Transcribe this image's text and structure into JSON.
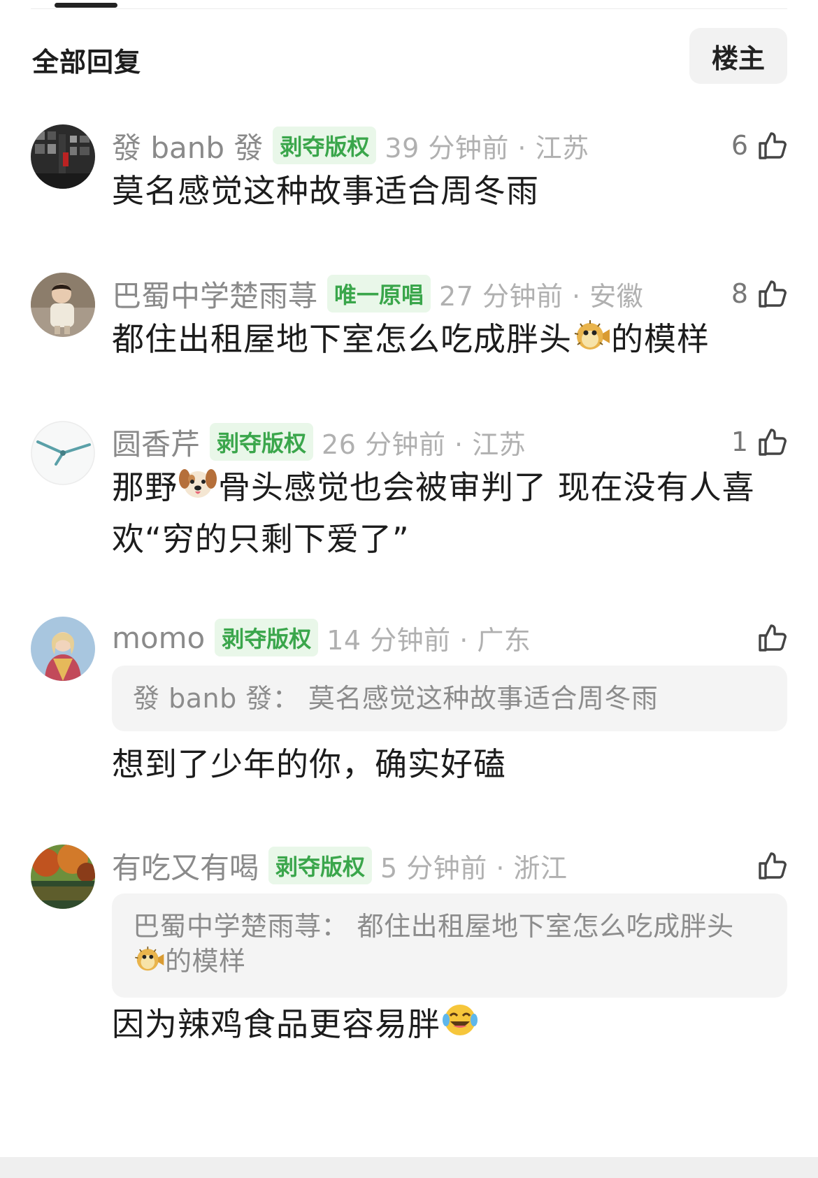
{
  "header": {
    "title": "全部回复",
    "op_button": "楼主"
  },
  "comments": [
    {
      "username": "發 banb 發",
      "badge": "剥夺版权",
      "time": "39 分钟前 · 江苏",
      "likes": "6",
      "text": "莫名感觉这种故事适合周冬雨"
    },
    {
      "username": "巴蜀中学楚雨荨",
      "badge": "唯一原唱",
      "time": "27 分钟前 · 安徽",
      "likes": "8",
      "text_before": "都住出租屋地下室怎么吃成胖头",
      "text_after": "的模样"
    },
    {
      "username": "圆香芹",
      "badge": "剥夺版权",
      "time": "26 分钟前 · 江苏",
      "likes": "1",
      "text_before": "那野",
      "text_after": "骨头感觉也会被审判了 现在没有人喜欢“穷的只剩下爱了”"
    },
    {
      "username": "momo",
      "badge": "剥夺版权",
      "time": "14 分钟前 · 广东",
      "likes": "",
      "quote": "發 banb 發： 莫名感觉这种故事适合周冬雨",
      "text": "想到了少年的你，确实好磕"
    },
    {
      "username": "有吃又有喝",
      "badge": "剥夺版权",
      "time": "5 分钟前 · 浙江",
      "likes": "",
      "quote_before": "巴蜀中学楚雨荨： 都住出租屋地下室怎么吃成胖头",
      "quote_after": "的模样",
      "text": "因为辣鸡食品更容易胖"
    }
  ],
  "icons": {
    "like": "thumbs-up-icon",
    "pufferfish": "pufferfish-emoji",
    "dog": "dog-face-emoji",
    "laugh": "tears-of-joy-emoji"
  },
  "colors": {
    "badge_text": "#3aa64b",
    "badge_bg": "#e9f7e9",
    "username": "#8a8a8a",
    "time": "#b0b0b0"
  }
}
